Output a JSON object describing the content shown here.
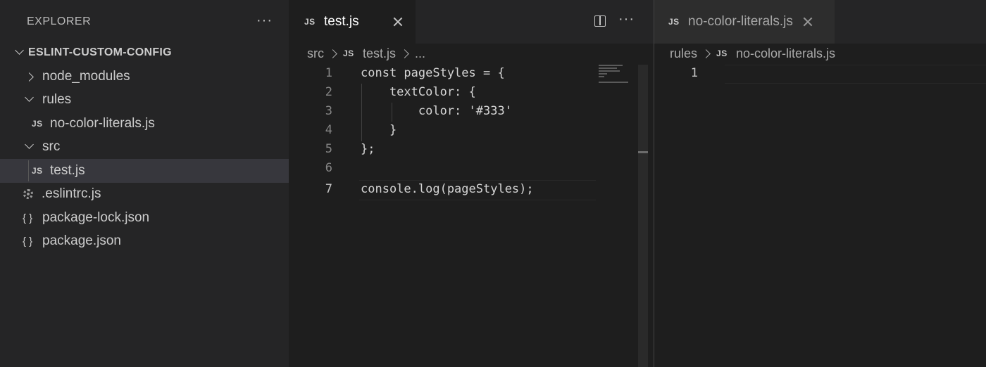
{
  "sidebar": {
    "title": "EXPLORER",
    "more_label": "···",
    "root": "ESLINT-CUSTOM-CONFIG",
    "items": [
      {
        "label": "node_modules",
        "icon": "chevron-right-icon"
      },
      {
        "label": "rules",
        "icon": "chevron-down-icon"
      },
      {
        "label": "no-color-literals.js",
        "badge": "JS"
      },
      {
        "label": "src",
        "icon": "chevron-down-icon"
      },
      {
        "label": "test.js",
        "badge": "JS",
        "selected": true
      },
      {
        "label": ".eslintrc.js",
        "icon": "gear-icon"
      },
      {
        "label": "package-lock.json",
        "badge": "{ }"
      },
      {
        "label": "package.json",
        "badge": "{ }"
      }
    ]
  },
  "editor1": {
    "tab": {
      "badge": "JS",
      "label": "test.js"
    },
    "more_label": "···",
    "breadcrumb": {
      "folder": "src",
      "badge": "JS",
      "file": "test.js",
      "tail": "..."
    },
    "line_numbers": [
      "1",
      "2",
      "3",
      "4",
      "5",
      "6",
      "7"
    ],
    "code": [
      "const pageStyles = {",
      "    textColor: {",
      "        color: '#333'",
      "    }",
      "};",
      "",
      "console.log(pageStyles);"
    ],
    "current_line": 7
  },
  "editor2": {
    "tab": {
      "badge": "JS",
      "label": "no-color-literals.js"
    },
    "breadcrumb": {
      "folder": "rules",
      "badge": "JS",
      "file": "no-color-literals.js"
    },
    "line_numbers": [
      "1"
    ]
  },
  "colors": {
    "sidebar_bg": "#252526",
    "editor_bg": "#1e1e1e",
    "selected_row": "#37373d",
    "text": "#cccccc",
    "line_number": "#858585"
  }
}
